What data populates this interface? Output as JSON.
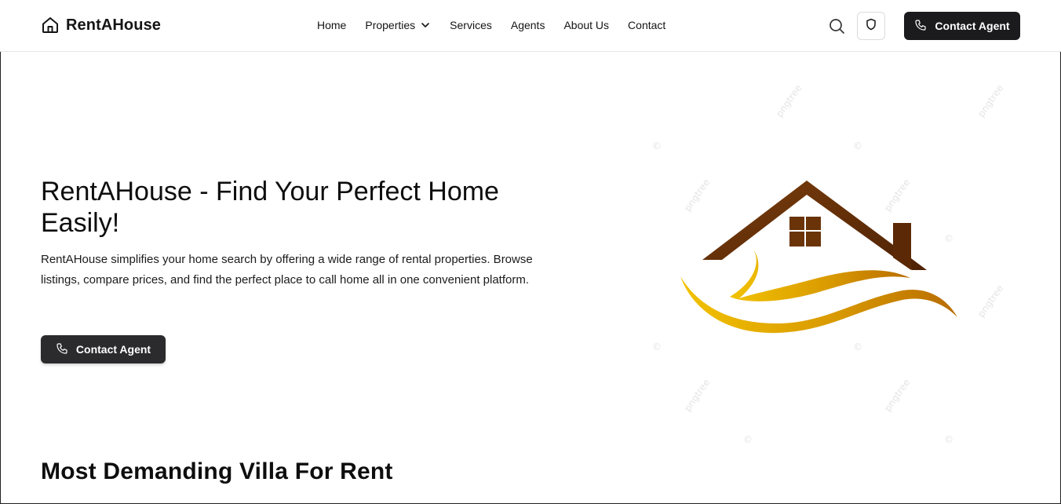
{
  "brand": {
    "name": "RentAHouse",
    "icon": "house-icon"
  },
  "nav": {
    "items": [
      {
        "label": "Home"
      },
      {
        "label": "Properties",
        "icon": "chevron-down-icon"
      },
      {
        "label": "Services"
      },
      {
        "label": "Agents"
      },
      {
        "label": "About Us"
      },
      {
        "label": "Contact"
      }
    ]
  },
  "header_actions": {
    "search_icon": "search-icon",
    "shield_icon": "shield-icon",
    "contact_label": "Contact Agent",
    "contact_icon": "phone-icon"
  },
  "hero": {
    "title": "RentAHouse - Find Your Perfect Home Easily!",
    "description": "RentAHouse simplifies your home search by offering a wide range of rental properties. Browse listings, compare prices, and find the perfect place to call home all in one convenient platform.",
    "cta_label": "Contact Agent",
    "cta_icon": "phone-icon",
    "image": {
      "watermark_text": "pngtree",
      "watermark_symbol": "©"
    }
  },
  "sections": {
    "featured_title": "Most Demanding Villa For Rent"
  },
  "colors": {
    "primary_button": "#1b1b1d",
    "roof_brown": "#6a3408",
    "wave_gold": "#e0a800"
  }
}
